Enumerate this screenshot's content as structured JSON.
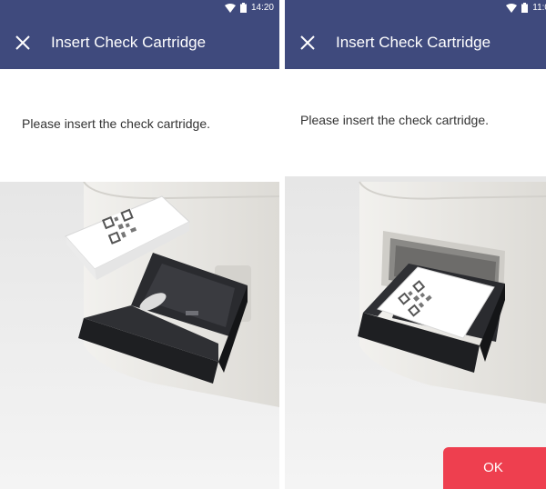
{
  "screens": [
    {
      "status": {
        "time": "14:20"
      },
      "header": {
        "title": "Insert Check Cartridge"
      },
      "message": "Please insert the  check cartridge."
    },
    {
      "status": {
        "time": "11:0"
      },
      "header": {
        "title": "Insert Check Cartridge"
      },
      "message": "Please insert the check cartridge."
    }
  ],
  "actions": {
    "ok_label": "OK"
  },
  "colors": {
    "header": "#3f4a7d",
    "ok_button": "#ee3f4f",
    "tray": "#1e1f22",
    "device": "#e9e7e3"
  },
  "icons": [
    "wifi-icon",
    "battery-icon",
    "close-icon"
  ]
}
